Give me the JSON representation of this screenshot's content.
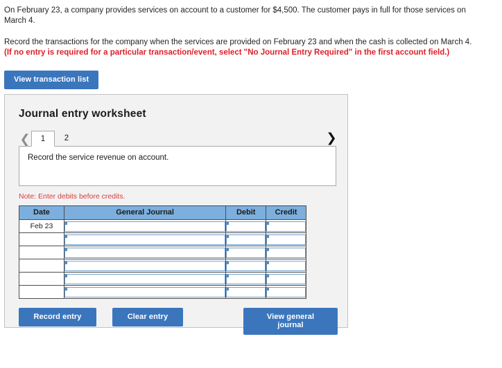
{
  "problem": {
    "scenario": "On February 23, a company provides services on account to a customer for $4,500. The customer pays in full for those services on March 4.",
    "instruction": "Record the transactions for the company when the services are provided on February 23 and when the cash is collected on March 4.",
    "warning": "(If no entry is required for a particular transaction/event, select \"No Journal Entry Required\" in the first account field.)"
  },
  "toolbar": {
    "view_transaction_list_label": "View transaction list"
  },
  "worksheet": {
    "title": "Journal entry worksheet",
    "prev_icon": "chevron-left-icon",
    "next_icon": "chevron-right-icon",
    "tabs": [
      {
        "label": "1",
        "active": true
      },
      {
        "label": "2",
        "active": false
      }
    ],
    "active_tab_description": "Record the service revenue on account.",
    "note": "Note: Enter debits before credits.",
    "table": {
      "columns": [
        "Date",
        "General Journal",
        "Debit",
        "Credit"
      ],
      "rows": [
        {
          "date": "Feb 23",
          "general_journal": "",
          "debit": "",
          "credit": ""
        },
        {
          "date": "",
          "general_journal": "",
          "debit": "",
          "credit": ""
        },
        {
          "date": "",
          "general_journal": "",
          "debit": "",
          "credit": ""
        },
        {
          "date": "",
          "general_journal": "",
          "debit": "",
          "credit": ""
        },
        {
          "date": "",
          "general_journal": "",
          "debit": "",
          "credit": ""
        },
        {
          "date": "",
          "general_journal": "",
          "debit": "",
          "credit": ""
        }
      ]
    },
    "buttons": {
      "record_entry_label": "Record entry",
      "clear_entry_label": "Clear entry",
      "view_general_journal_label": "View general journal"
    }
  },
  "colors": {
    "button_blue": "#3b76bd",
    "table_header_blue": "#7cafdd",
    "warning_red": "#dd1f26",
    "note_red": "#dd3b3b",
    "panel_background": "#f2f2f2",
    "input_border_blue": "#6e9fd0"
  }
}
